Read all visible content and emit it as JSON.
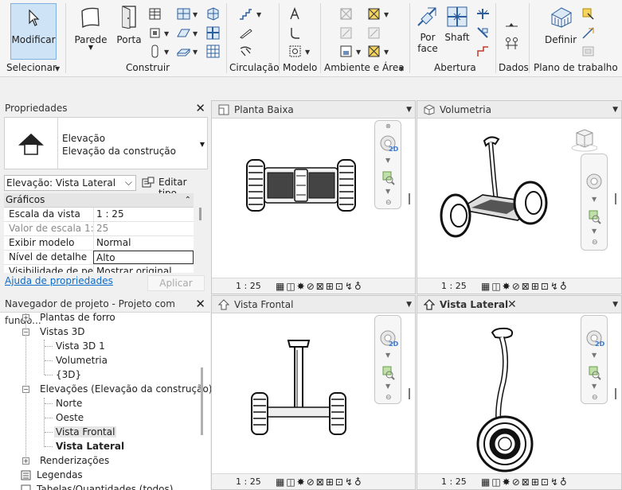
{
  "ribbon": {
    "modify": "Modificar",
    "select": "Selecionar",
    "wall": "Parede",
    "door": "Porta",
    "build": "Construir",
    "circulation": "Circulação",
    "model": "Modelo",
    "room_area": "Ambiente e Área",
    "by_face_1": "Por",
    "by_face_2": "face",
    "shaft": "Shaft",
    "opening": "Abertura",
    "data": "Dados",
    "define": "Definir",
    "work_plane": "Plano de trabalho"
  },
  "properties": {
    "title": "Propriedades",
    "type_name": "Elevação",
    "type_sub": "Elevação da construção",
    "selector": "Elevação: Vista Lateral",
    "edit_type": "Editar tipo",
    "group": "Gráficos",
    "rows": [
      {
        "k": "Escala da vista",
        "v": "1 : 25"
      },
      {
        "k": "Valor de escala    1:",
        "v": "25"
      },
      {
        "k": "Exibir modelo",
        "v": "Normal"
      },
      {
        "k": "Nível de detalhe",
        "v": "Alto"
      },
      {
        "k": "Visibilidade de pe...",
        "v": "Mostrar original"
      }
    ],
    "help": "Ajuda de propriedades",
    "apply": "Aplicar"
  },
  "browser": {
    "title": "Navegador de projeto - Projeto com fundo...",
    "items": [
      "Plantas de forro",
      "Vistas 3D",
      "Vista 3D 1",
      "Volumetria",
      "{3D}",
      "Elevações (Elevação da construção)",
      "Norte",
      "Oeste",
      "Vista Frontal",
      "Vista Lateral",
      "Renderizações",
      "Legendas",
      "Tabelas/Quantidades (todos)"
    ]
  },
  "views": {
    "v1": {
      "title": "Planta Baixa",
      "scale": "1 : 25"
    },
    "v2": {
      "title": "Volumetria",
      "scale": "1 : 25"
    },
    "v3": {
      "title": "Vista Frontal",
      "scale": "1 : 25"
    },
    "v4": {
      "title": "Vista Lateral",
      "scale": "1 : 25"
    }
  },
  "nav_badge": "2D",
  "colors": {
    "accent": "#0c6cc7",
    "select_bg": "#cde4f7",
    "panel_border": "#c9c9c9"
  }
}
